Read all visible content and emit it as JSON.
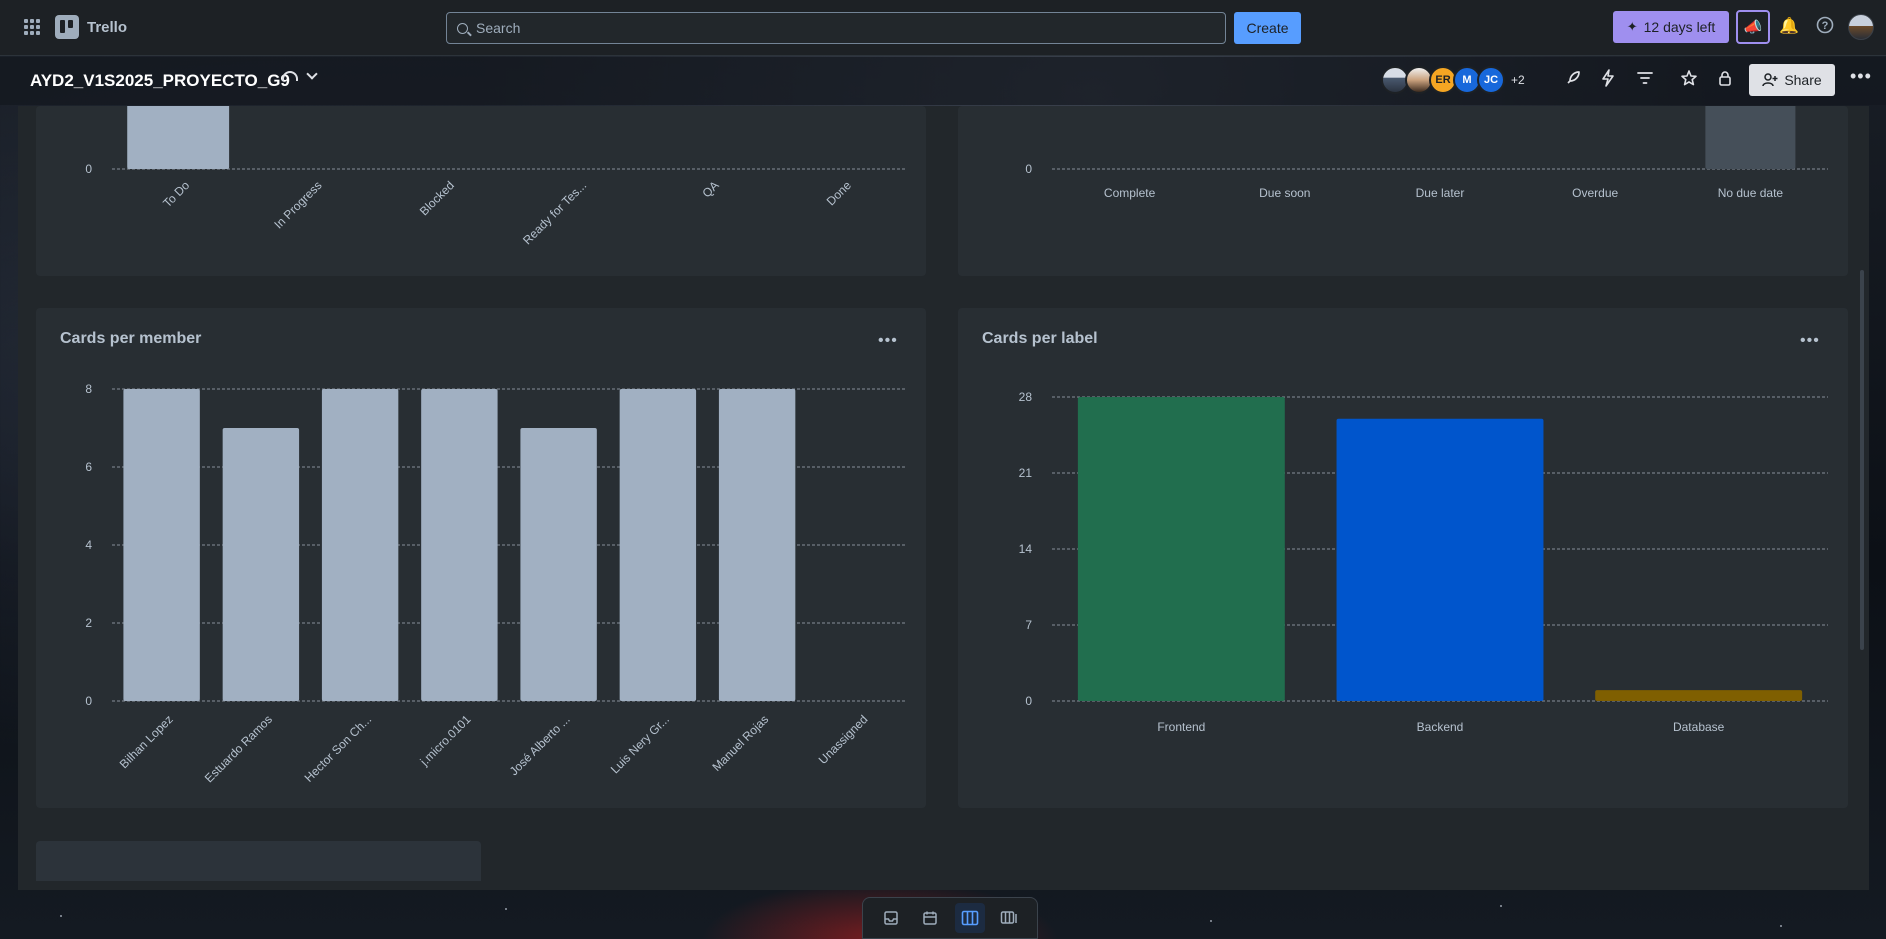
{
  "topbar": {
    "app_name": "Trello",
    "search_placeholder": "Search",
    "create_label": "Create",
    "trial_label": "12 days left"
  },
  "board": {
    "title": "AYD2_V1S2025_PROYECTO_G9",
    "members": [
      "ER",
      "M",
      "JC"
    ],
    "members_more": "+2",
    "share_label": "Share"
  },
  "panels": {
    "cards_per_member_title": "Cards per member",
    "cards_per_label_title": "Cards per label"
  },
  "chart_data": [
    {
      "type": "bar",
      "title": "",
      "categories": [
        "To Do",
        "In Progress",
        "Blocked",
        "Ready for Tes...",
        "QA",
        "Done"
      ],
      "values": [
        1,
        0,
        0,
        0,
        0,
        0
      ],
      "ylim": [
        0,
        1
      ],
      "yticks": [
        0
      ],
      "colors": [
        "#a1b0c2"
      ],
      "note_visible": "partially scrolled"
    },
    {
      "type": "bar",
      "title": "",
      "categories": [
        "Complete",
        "Due soon",
        "Due later",
        "Overdue",
        "No due date"
      ],
      "values": [
        0,
        0,
        0,
        0,
        1
      ],
      "ylim": [
        0,
        1
      ],
      "yticks": [
        0
      ],
      "colors": [
        "#454f59"
      ]
    },
    {
      "type": "bar",
      "title": "Cards per member",
      "categories": [
        "Bilhan Lopez",
        "Estuardo Ramos",
        "Hector Son Ch...",
        "j.micro.0101",
        "José Alberto ...",
        "Luis Nery Gr...",
        "Manuel Rojas",
        "Unassigned"
      ],
      "values": [
        8,
        7,
        8,
        8,
        7,
        8,
        8,
        0
      ],
      "ylim": [
        0,
        8
      ],
      "yticks": [
        0,
        2,
        4,
        6,
        8
      ],
      "colors": [
        "#a1b0c2"
      ]
    },
    {
      "type": "bar",
      "title": "Cards per label",
      "categories": [
        "Frontend",
        "Backend",
        "Database"
      ],
      "values": [
        28,
        26,
        1
      ],
      "ylim": [
        0,
        28
      ],
      "yticks": [
        0,
        7,
        14,
        21,
        28
      ],
      "colors": [
        "#216e4e",
        "#0055cc",
        "#7f5f01"
      ]
    }
  ]
}
